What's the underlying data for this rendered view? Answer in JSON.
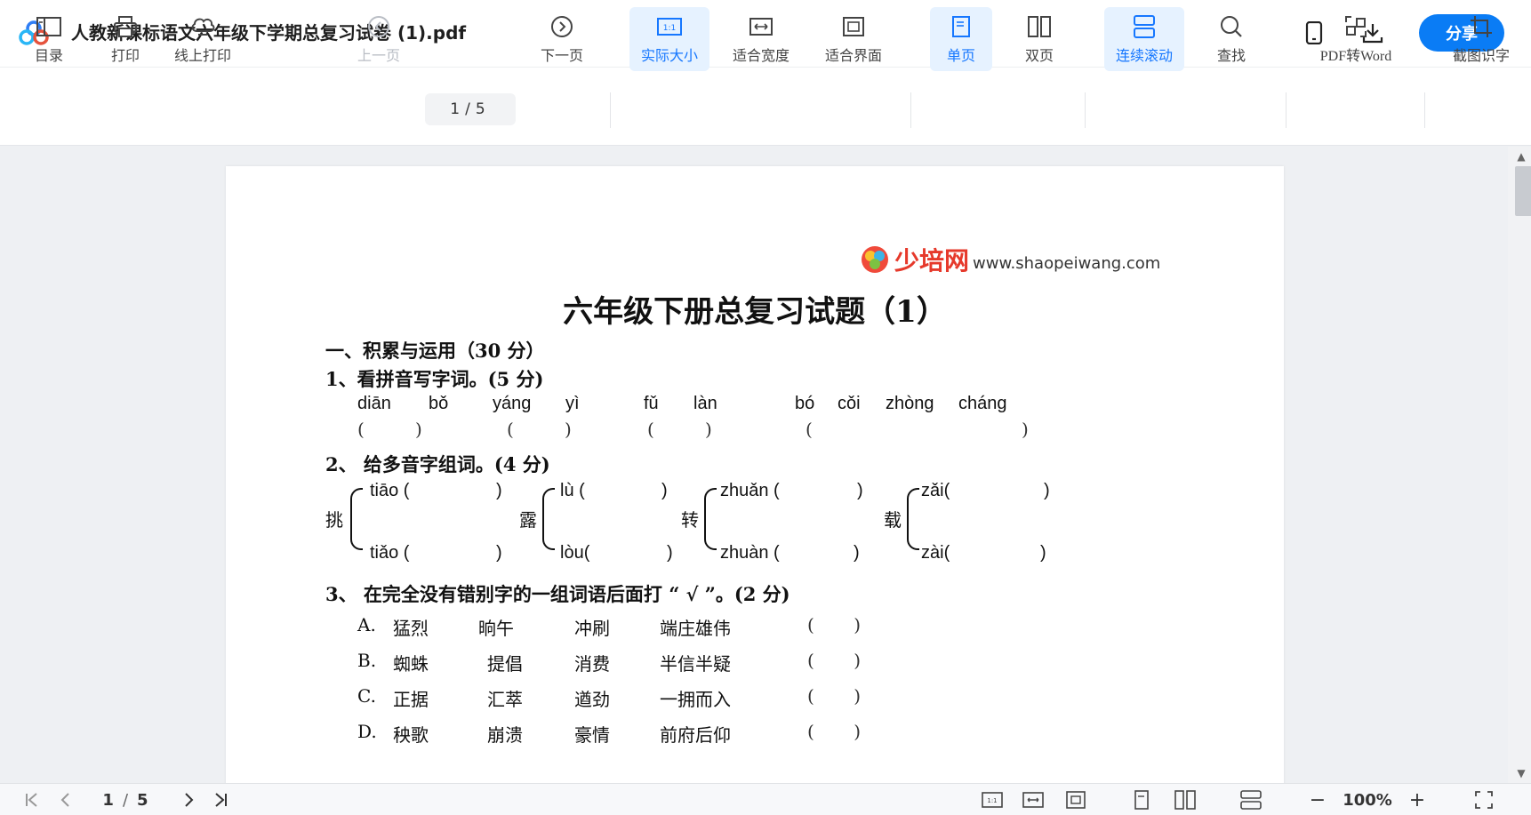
{
  "window": {
    "title": "人教新课标语文六年级下学期总复习试卷 (1).pdf",
    "share_label": "分享"
  },
  "toolbar": {
    "toc": "目录",
    "print": "打印",
    "online_print": "线上打印",
    "prev_page": "上一页",
    "page_current": "1",
    "page_sep": "/",
    "page_total": "5",
    "next_page": "下一页",
    "actual_size": "实际大小",
    "fit_width": "适合宽度",
    "fit_screen": "适合界面",
    "single_page": "单页",
    "double_page": "双页",
    "continuous_scroll": "连续滚动",
    "find": "查找",
    "pdf_to_word": "PDF转Word",
    "ocr": "截图识字"
  },
  "document": {
    "brand_name": "少培网",
    "brand_url": "www.shaopeiwang.com",
    "title": "六年级下册总复习试题（1）",
    "section1": "一、积累与运用（30 分）",
    "q1": "1、看拼音写字词。(5 分)",
    "q1_pinyin": [
      "diān",
      "bǒ",
      "yáng",
      "yì",
      "fǔ",
      "làn",
      "bó",
      "cǒi",
      "zhòng",
      "cháng"
    ],
    "q2": "2、 给多音字组词。(4 分)",
    "q2_chars": [
      "挑",
      "露",
      "转",
      "载"
    ],
    "q2_top": [
      "tiāo (",
      "lù (",
      "zhuǎn (",
      "zǎi("
    ],
    "q2_bottom": [
      "tiǎo (",
      "lòu(",
      "zhuàn (",
      "zài("
    ],
    "q3": "3、 在完全没有错别字的一组词语后面打 “ √ ”。(2 分)",
    "q3_rows": [
      {
        "label": "A.",
        "w1": "猛烈",
        "w2": "晌午",
        "w3": "冲刷",
        "w4": "端庄雄伟"
      },
      {
        "label": "B.",
        "w1": "蜘蛛",
        "w2": "提倡",
        "w3": "消费",
        "w4": "半信半疑"
      },
      {
        "label": "C.",
        "w1": "正据",
        "w2": "汇萃",
        "w3": "遒劲",
        "w4": "一拥而入"
      },
      {
        "label": "D.",
        "w1": "秧歌",
        "w2": "崩溃",
        "w3": "豪情",
        "w4": "前府后仰"
      }
    ]
  },
  "statusbar": {
    "page_current": "1",
    "page_sep": "/",
    "page_total": "5",
    "zoom": "100%"
  },
  "colors": {
    "accent": "#1677ff",
    "share": "#0a7cf5"
  }
}
